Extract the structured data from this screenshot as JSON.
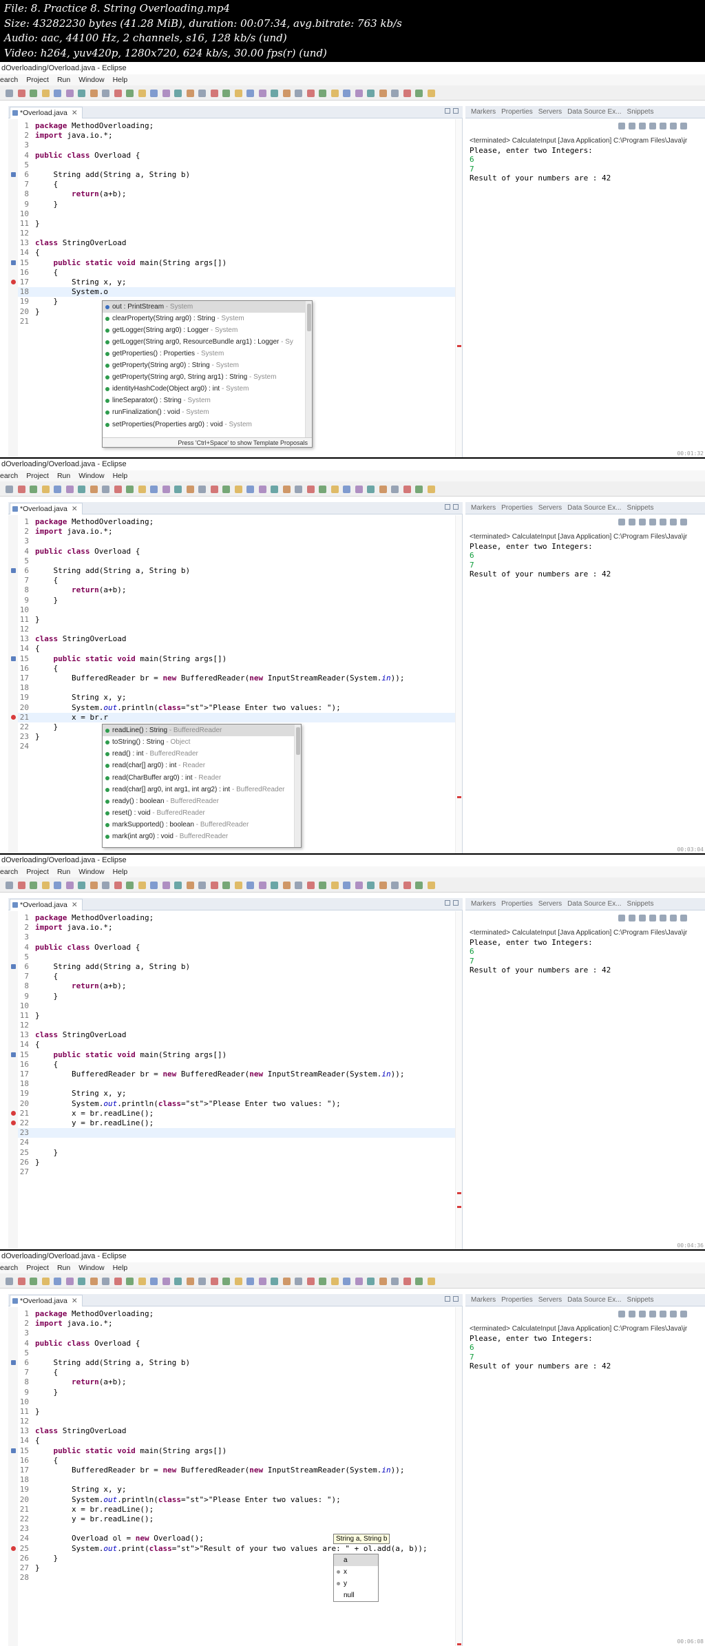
{
  "video_info": [
    "File: 8. Practice 8. String Overloading.mp4",
    "Size: 43282230 bytes (41.28 MiB), duration: 00:07:34, avg.bitrate: 763 kb/s",
    "Audio: aac, 44100 Hz, 2 channels, s16, 128 kb/s (und)",
    "Video: h264, yuv420p, 1280x720, 624 kb/s, 30.00 fps(r) (und)"
  ],
  "window_title": "dOverloading/Overload.java - Eclipse",
  "menu": [
    "earch",
    "Project",
    "Run",
    "Window",
    "Help"
  ],
  "editor_tab": "*Overload.java",
  "editor_tab_close": "✕",
  "right_tabs": [
    "Markers",
    "Properties",
    "Servers",
    "Data Source Ex...",
    "Snippets"
  ],
  "console": {
    "terminated": "<terminated> CalculateInput [Java Application] C:\\Program Files\\Java\\jr",
    "prompt": "Please, enter two Integers:",
    "input1": "6",
    "input2": "7",
    "result": "Result of your numbers are : 42"
  },
  "frames": [
    {
      "lines": [
        {
          "n": "1",
          "text": "package MethodOverloading;"
        },
        {
          "n": "2",
          "text": "import java.io.*;"
        },
        {
          "n": "3",
          "text": ""
        },
        {
          "n": "4",
          "text": "public class Overload {"
        },
        {
          "n": "5",
          "text": ""
        },
        {
          "n": "6",
          "text": "    String add(String a, String b)"
        },
        {
          "n": "7",
          "text": "    {"
        },
        {
          "n": "8",
          "text": "        return(a+b);"
        },
        {
          "n": "9",
          "text": "    }"
        },
        {
          "n": "10",
          "text": ""
        },
        {
          "n": "11",
          "text": "}"
        },
        {
          "n": "12",
          "text": ""
        },
        {
          "n": "13",
          "text": "class StringOverLoad"
        },
        {
          "n": "14",
          "text": "{"
        },
        {
          "n": "15",
          "text": "    public static void main(String args[])"
        },
        {
          "n": "16",
          "text": "    {"
        },
        {
          "n": "17",
          "text": "        String x, y;"
        },
        {
          "n": "18",
          "text": "        System.o"
        },
        {
          "n": "19",
          "text": "    }"
        },
        {
          "n": "20",
          "text": "}"
        },
        {
          "n": "21",
          "text": ""
        }
      ],
      "autocomplete": {
        "items": [
          "out : PrintStream - System",
          "clearProperty(String arg0) : String - System",
          "getLogger(String arg0) : Logger - System",
          "getLogger(String arg0, ResourceBundle arg1) : Logger - Sy",
          "getProperties() : Properties - System",
          "getProperty(String arg0) : String - System",
          "getProperty(String arg0, String arg1) : String - System",
          "identityHashCode(Object arg0) : int - System",
          "lineSeparator() : String - System",
          "runFinalization() : void - System",
          "setProperties(Properties arg0) : void - System"
        ],
        "footer": "Press 'Ctrl+Space' to show Template Proposals"
      }
    },
    {
      "lines": [
        {
          "n": "1",
          "text": "package MethodOverloading;"
        },
        {
          "n": "2",
          "text": "import java.io.*;"
        },
        {
          "n": "3",
          "text": ""
        },
        {
          "n": "4",
          "text": "public class Overload {"
        },
        {
          "n": "5",
          "text": ""
        },
        {
          "n": "6",
          "text": "    String add(String a, String b)"
        },
        {
          "n": "7",
          "text": "    {"
        },
        {
          "n": "8",
          "text": "        return(a+b);"
        },
        {
          "n": "9",
          "text": "    }"
        },
        {
          "n": "10",
          "text": ""
        },
        {
          "n": "11",
          "text": "}"
        },
        {
          "n": "12",
          "text": ""
        },
        {
          "n": "13",
          "text": "class StringOverLoad"
        },
        {
          "n": "14",
          "text": "{"
        },
        {
          "n": "15",
          "text": "    public static void main(String args[])"
        },
        {
          "n": "16",
          "text": "    {"
        },
        {
          "n": "17",
          "text": "        BufferedReader br = new BufferedReader(new InputStreamReader(System.in));"
        },
        {
          "n": "18",
          "text": ""
        },
        {
          "n": "19",
          "text": "        String x, y;"
        },
        {
          "n": "20",
          "text": "        System.out.println(\"Please Enter two values: \");"
        },
        {
          "n": "21",
          "text": "        x = br.r"
        },
        {
          "n": "22",
          "text": "    }"
        },
        {
          "n": "23",
          "text": "}"
        },
        {
          "n": "24",
          "text": ""
        }
      ],
      "autocomplete": {
        "items": [
          "readLine() : String - BufferedReader",
          "toString() : String - Object",
          "read() : int - BufferedReader",
          "read(char[] arg0) : int - Reader",
          "read(CharBuffer arg0) : int - Reader",
          "read(char[] arg0, int arg1, int arg2) : int - BufferedReader",
          "ready() : boolean - BufferedReader",
          "reset() : void - BufferedReader",
          "markSupported() : boolean - BufferedReader",
          "mark(int arg0) : void - BufferedReader"
        ]
      }
    },
    {
      "lines": [
        {
          "n": "1",
          "text": "package MethodOverloading;"
        },
        {
          "n": "2",
          "text": "import java.io.*;"
        },
        {
          "n": "3",
          "text": ""
        },
        {
          "n": "4",
          "text": "public class Overload {"
        },
        {
          "n": "5",
          "text": ""
        },
        {
          "n": "6",
          "text": "    String add(String a, String b)"
        },
        {
          "n": "7",
          "text": "    {"
        },
        {
          "n": "8",
          "text": "        return(a+b);"
        },
        {
          "n": "9",
          "text": "    }"
        },
        {
          "n": "10",
          "text": ""
        },
        {
          "n": "11",
          "text": "}"
        },
        {
          "n": "12",
          "text": ""
        },
        {
          "n": "13",
          "text": "class StringOverLoad"
        },
        {
          "n": "14",
          "text": "{"
        },
        {
          "n": "15",
          "text": "    public static void main(String args[])"
        },
        {
          "n": "16",
          "text": "    {"
        },
        {
          "n": "17",
          "text": "        BufferedReader br = new BufferedReader(new InputStreamReader(System.in));"
        },
        {
          "n": "18",
          "text": ""
        },
        {
          "n": "19",
          "text": "        String x, y;"
        },
        {
          "n": "20",
          "text": "        System.out.println(\"Please Enter two values: \");"
        },
        {
          "n": "21",
          "text": "        x = br.readLine();"
        },
        {
          "n": "22",
          "text": "        y = br.readLine();"
        },
        {
          "n": "23",
          "text": ""
        },
        {
          "n": "24",
          "text": ""
        },
        {
          "n": "25",
          "text": "    }"
        },
        {
          "n": "26",
          "text": "}"
        },
        {
          "n": "27",
          "text": ""
        }
      ]
    },
    {
      "lines": [
        {
          "n": "1",
          "text": "package MethodOverloading;"
        },
        {
          "n": "2",
          "text": "import java.io.*;"
        },
        {
          "n": "3",
          "text": ""
        },
        {
          "n": "4",
          "text": "public class Overload {"
        },
        {
          "n": "5",
          "text": ""
        },
        {
          "n": "6",
          "text": "    String add(String a, String b)"
        },
        {
          "n": "7",
          "text": "    {"
        },
        {
          "n": "8",
          "text": "        return(a+b);"
        },
        {
          "n": "9",
          "text": "    }"
        },
        {
          "n": "10",
          "text": ""
        },
        {
          "n": "11",
          "text": "}"
        },
        {
          "n": "12",
          "text": ""
        },
        {
          "n": "13",
          "text": "class StringOverLoad"
        },
        {
          "n": "14",
          "text": "{"
        },
        {
          "n": "15",
          "text": "    public static void main(String args[])"
        },
        {
          "n": "16",
          "text": "    {"
        },
        {
          "n": "17",
          "text": "        BufferedReader br = new BufferedReader(new InputStreamReader(System.in));"
        },
        {
          "n": "18",
          "text": ""
        },
        {
          "n": "19",
          "text": "        String x, y;"
        },
        {
          "n": "20",
          "text": "        System.out.println(\"Please Enter two values: \");"
        },
        {
          "n": "21",
          "text": "        x = br.readLine();"
        },
        {
          "n": "22",
          "text": "        y = br.readLine();"
        },
        {
          "n": "23",
          "text": ""
        },
        {
          "n": "24",
          "text": "        Overload ol = new Overload();"
        },
        {
          "n": "25",
          "text": "        System.out.print(\"Result of your two values are: \" + ol.add(a, b));"
        },
        {
          "n": "26",
          "text": "    }"
        },
        {
          "n": "27",
          "text": "}"
        },
        {
          "n": "28",
          "text": ""
        }
      ],
      "param_hint": "String a, String b",
      "param_items": [
        "a",
        "x",
        "y",
        "null"
      ]
    }
  ],
  "timestamps": [
    "00:01:32",
    "00:03:04",
    "00:04:36",
    "00:06:08"
  ]
}
